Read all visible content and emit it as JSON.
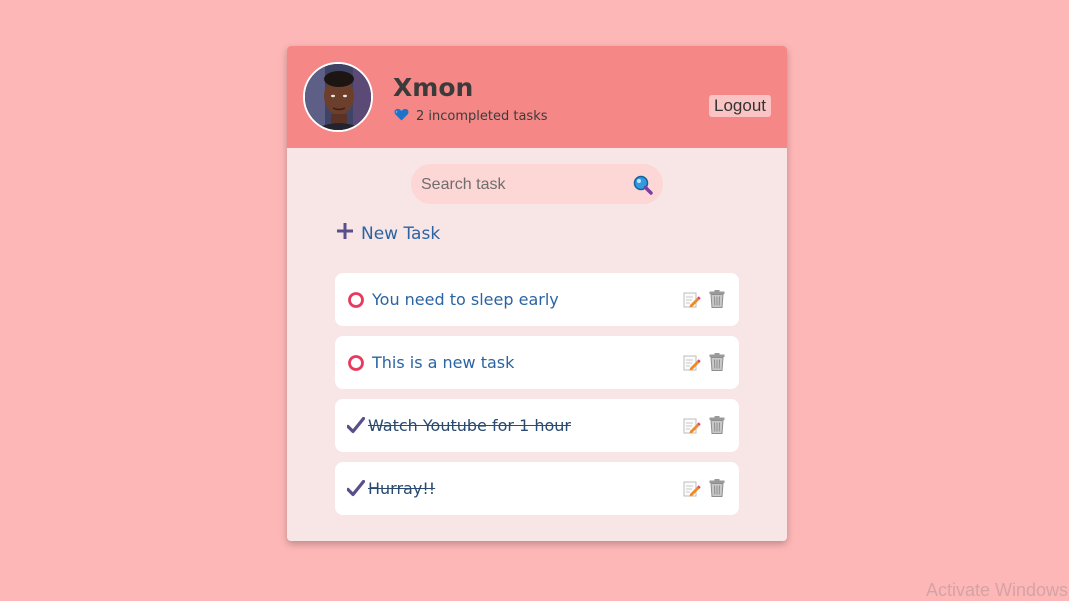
{
  "header": {
    "username": "Xmon",
    "status_text": "2 incompleted tasks",
    "logout_label": "Logout"
  },
  "search": {
    "placeholder": "Search task"
  },
  "new_task_label": "New Task",
  "tasks": [
    {
      "text": "You need to sleep early",
      "completed": false
    },
    {
      "text": "This is a new task",
      "completed": false
    },
    {
      "text": "Watch Youtube for 1 hour",
      "completed": true
    },
    {
      "text": "Hurray!!",
      "completed": true
    }
  ],
  "watermark": "Activate Windows",
  "colors": {
    "background": "#feb7b7",
    "header": "#f68787",
    "card_body": "#f8e5e5",
    "accent_text": "#2a64a3",
    "incomplete_ring": "#e8395f",
    "check": "#5a4f8a"
  }
}
